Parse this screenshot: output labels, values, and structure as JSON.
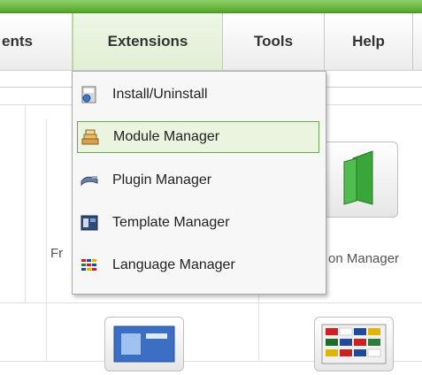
{
  "menubar": {
    "items": [
      {
        "label": "ents"
      },
      {
        "label": "Extensions"
      },
      {
        "label": "Tools"
      },
      {
        "label": "Help"
      }
    ]
  },
  "dropdown": {
    "items": [
      {
        "label": "Install/Uninstall",
        "icon": "install-icon"
      },
      {
        "label": "Module Manager",
        "icon": "module-icon"
      },
      {
        "label": "Plugin Manager",
        "icon": "plugin-icon"
      },
      {
        "label": "Template Manager",
        "icon": "template-icon"
      },
      {
        "label": "Language Manager",
        "icon": "language-icon"
      }
    ]
  },
  "background_labels": {
    "left": "Fr",
    "right": "on Manager"
  },
  "colors": {
    "topbar": "#6ab83d",
    "hover_border": "#6aa84f",
    "hover_bg": "#eaf4df"
  }
}
